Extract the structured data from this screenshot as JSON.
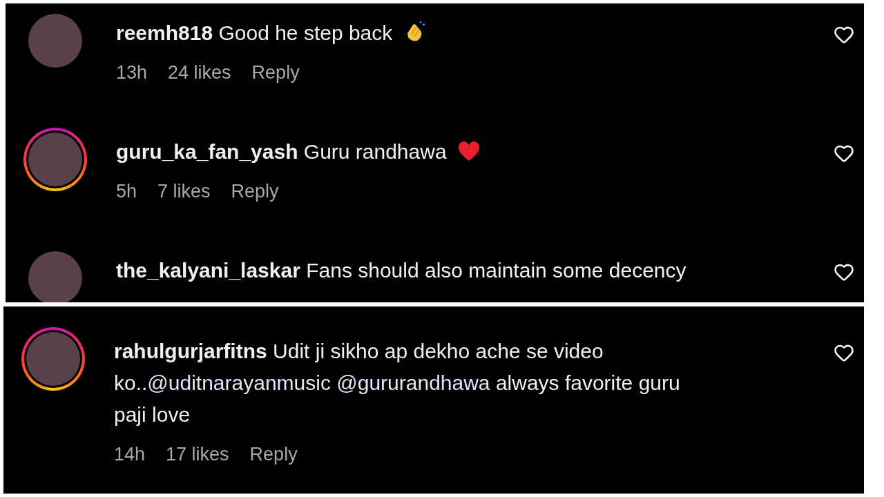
{
  "panels": [
    {
      "comments": [
        {
          "username": "reemh818",
          "story_ring": false,
          "body": [
            {
              "kind": "text",
              "text": "Good he step back"
            }
          ],
          "emoji": {
            "kind": "clap"
          },
          "time": "13h",
          "likes": "24 likes",
          "reply": "Reply"
        },
        {
          "username": "guru_ka_fan_yash",
          "story_ring": true,
          "body": [
            {
              "kind": "text",
              "text": "Guru randhawa"
            }
          ],
          "emoji": {
            "kind": "heart"
          },
          "time": "5h",
          "likes": "7 likes",
          "reply": "Reply"
        },
        {
          "username": "the_kalyani_laskar",
          "story_ring": false,
          "body": [
            {
              "kind": "text",
              "text": "Fans should also maintain some decency"
            }
          ]
        }
      ]
    },
    {
      "comments": [
        {
          "username": "rahulgurjarfitns",
          "story_ring": true,
          "body": [
            {
              "kind": "text",
              "text": "Udit ji sikho ap dekho ache se video ko.."
            },
            {
              "kind": "mention",
              "text": "@uditnarayanmusic"
            },
            {
              "kind": "mention",
              "text": "@gururandhawa"
            },
            {
              "kind": "text",
              "text": " always favorite guru paji love"
            }
          ],
          "time": "14h",
          "likes": "17 likes",
          "reply": "Reply"
        }
      ]
    }
  ]
}
